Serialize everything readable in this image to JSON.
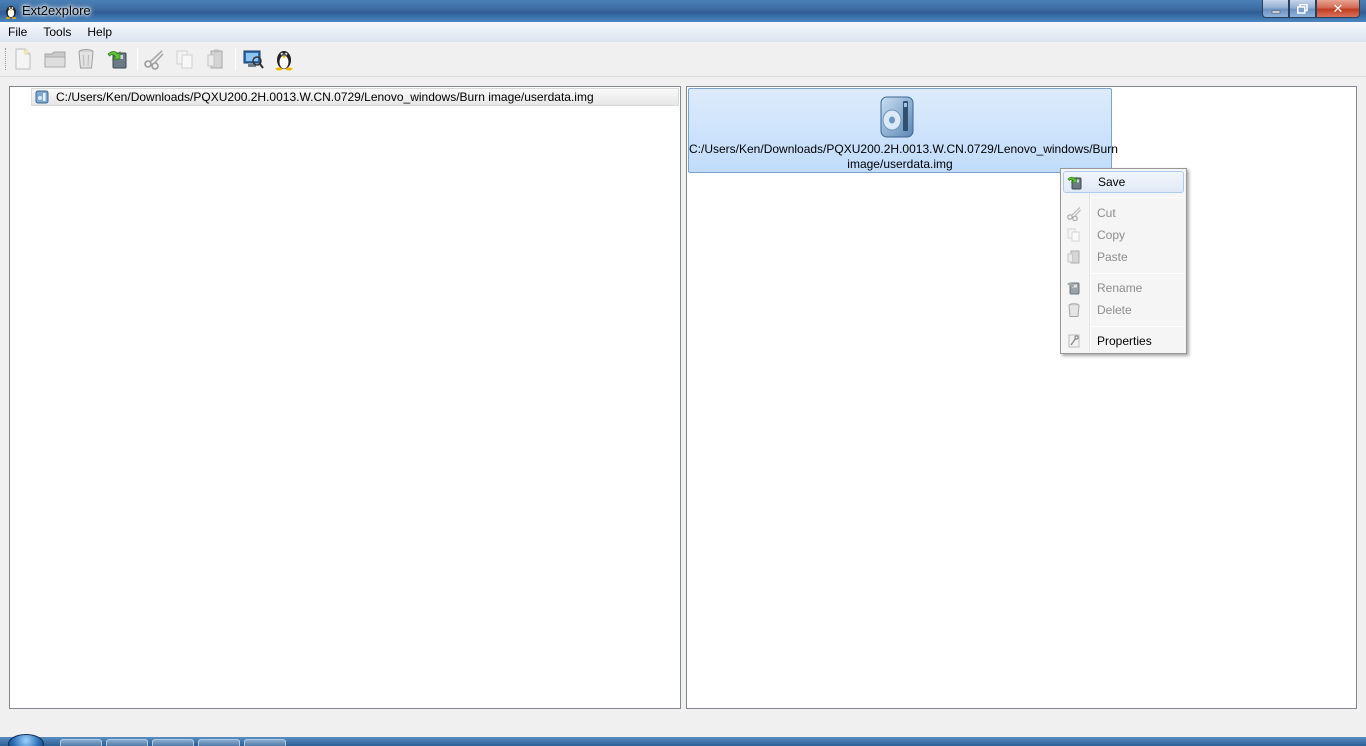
{
  "window": {
    "title": "Ext2explore",
    "controls": {
      "close": "✕"
    }
  },
  "menu": {
    "items": [
      "File",
      "Tools",
      "Help"
    ]
  },
  "toolbar": {
    "buttons": [
      {
        "name": "new-icon",
        "enabled": false
      },
      {
        "name": "open-folder-icon",
        "enabled": false
      },
      {
        "name": "delete-icon",
        "enabled": false
      },
      {
        "name": "save-icon",
        "enabled": true
      },
      {
        "name": "cut-icon",
        "enabled": false
      },
      {
        "name": "copy-icon",
        "enabled": false
      },
      {
        "name": "paste-icon",
        "enabled": false
      },
      {
        "name": "rescan-disk-icon",
        "enabled": true
      },
      {
        "name": "linux-tux-icon",
        "enabled": true
      }
    ]
  },
  "tree": {
    "root_path": "C:/Users/Ken/Downloads/PQXU200.2H.0013.W.CN.0729/Lenovo_windows/Burn image/userdata.img"
  },
  "file_view": {
    "item_label_line1": "C:/Users/Ken/Downloads/PQXU200.2H.0013.W.CN.0729/Lenovo_windows/Burn",
    "item_label_line2": "image/userdata.img"
  },
  "context_menu": {
    "items": [
      {
        "label": "Save",
        "enabled": true,
        "icon": "save-icon"
      },
      {
        "label": "Cut",
        "enabled": false,
        "icon": "cut-icon"
      },
      {
        "label": "Copy",
        "enabled": false,
        "icon": "copy-icon"
      },
      {
        "label": "Paste",
        "enabled": false,
        "icon": "paste-icon"
      },
      {
        "label": "Rename",
        "enabled": false,
        "icon": "rename-icon"
      },
      {
        "label": "Delete",
        "enabled": false,
        "icon": "delete-icon"
      },
      {
        "label": "Properties",
        "enabled": true,
        "icon": "properties-icon"
      }
    ]
  },
  "colors": {
    "selection_bg": "#c1dcfc",
    "selection_border": "#7da2ce",
    "disabled_text": "#8d8d8d"
  }
}
